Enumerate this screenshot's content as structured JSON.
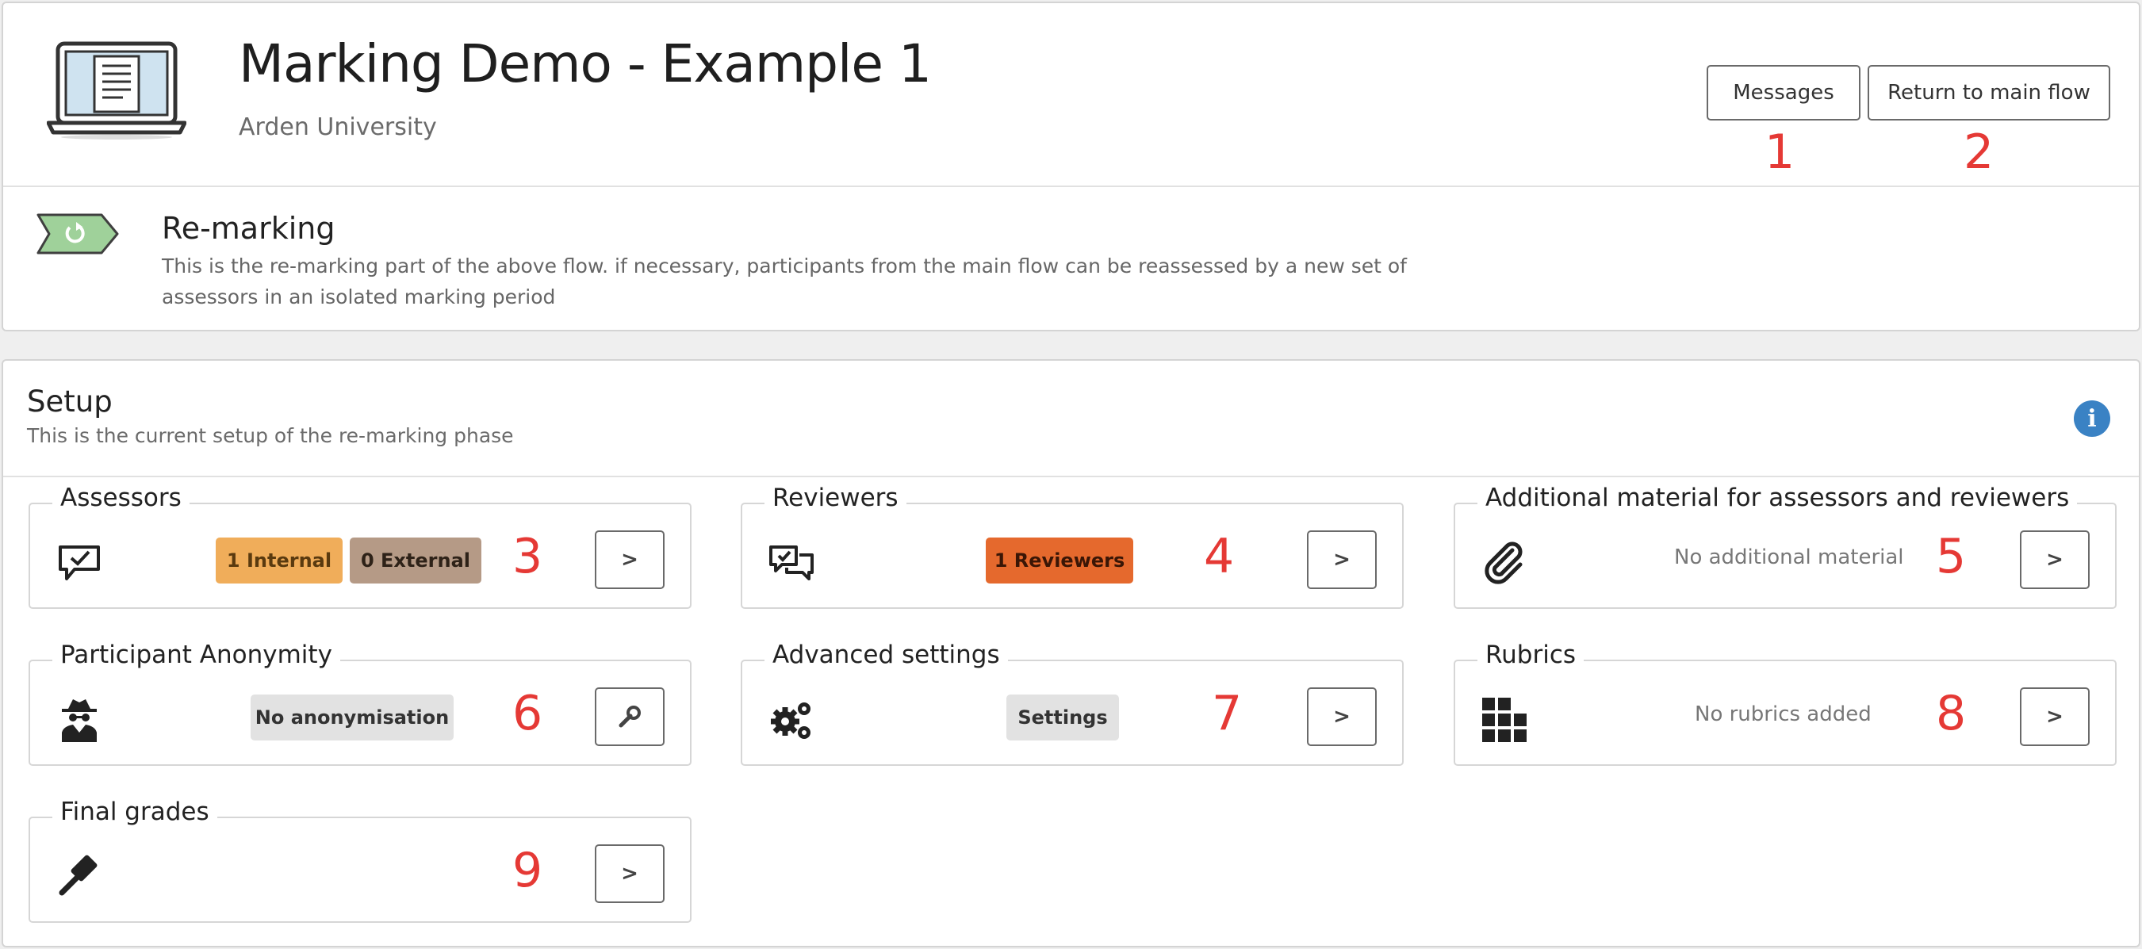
{
  "header": {
    "title": "Marking Demo - Example 1",
    "subtitle": "Arden University",
    "messages_label": "Messages",
    "return_label": "Return to main flow",
    "section_title": "Re-marking",
    "section_desc": "This is the re-marking part of the above flow. if necessary, participants from the main flow can be reassessed by a new set of assessors in an isolated marking period"
  },
  "setup": {
    "title": "Setup",
    "description": "This is the current setup of the re-marking phase",
    "info_icon": "info-icon",
    "panels": {
      "assessors": {
        "label": "Assessors",
        "internal": "1 Internal",
        "external": "0 External",
        "icon": "comment-check-icon"
      },
      "reviewers": {
        "label": "Reviewers",
        "badge": "1 Reviewers",
        "icon": "comments-check-icon"
      },
      "material": {
        "label": "Additional material for assessors and reviewers",
        "text": "No additional material",
        "icon": "paperclip-icon"
      },
      "anonymity": {
        "label": "Participant Anonymity",
        "badge": "No anonymisation",
        "icon": "spy-icon"
      },
      "advanced": {
        "label": "Advanced settings",
        "badge": "Settings",
        "icon": "gears-icon"
      },
      "rubrics": {
        "label": "Rubrics",
        "text": "No rubrics added",
        "icon": "grid-icon"
      },
      "grades": {
        "label": "Final grades",
        "icon": "gavel-icon"
      }
    }
  },
  "annotations": [
    "1",
    "2",
    "3",
    "4",
    "5",
    "6",
    "7",
    "8",
    "9"
  ],
  "colors": {
    "internal_badge": "#f0ad5a",
    "external_badge": "#b59a86",
    "reviewers_badge": "#e5692d",
    "neutral_badge": "#e2e2e2",
    "annotation": "#e53935",
    "info": "#3a82c4",
    "flag": "#9fd19a"
  }
}
